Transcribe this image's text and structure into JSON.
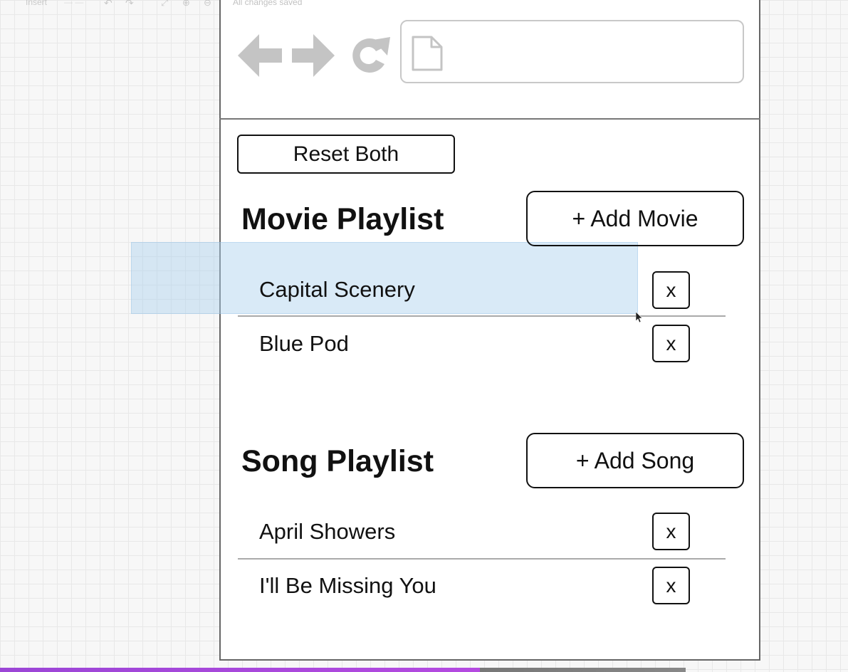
{
  "editor": {
    "menu_label": "Insert",
    "dim_label": "— —",
    "undo_icon": "undo-icon",
    "redo_icon": "redo-icon",
    "save_status": "All changes saved"
  },
  "browser": {
    "nav_icons": [
      "back-arrow-icon",
      "forward-arrow-icon",
      "reload-icon"
    ],
    "url_icon": "document-icon",
    "url_value": ""
  },
  "app": {
    "reset_label": "Reset Both",
    "movies": {
      "title": "Movie Playlist",
      "add_label": "+ Add Movie",
      "items": [
        {
          "label": "Capital Scenery",
          "remove_label": "x"
        },
        {
          "label": "Blue Pod",
          "remove_label": "x"
        }
      ]
    },
    "songs": {
      "title": "Song Playlist",
      "add_label": "+ Add Song",
      "items": [
        {
          "label": "April Showers",
          "remove_label": "x"
        },
        {
          "label": "I'll Be Missing You",
          "remove_label": "x"
        }
      ]
    }
  },
  "colors": {
    "icon_gray": "#c4c4c4",
    "selection": "#aad0ee",
    "accent_strip": "#b44ae0"
  }
}
